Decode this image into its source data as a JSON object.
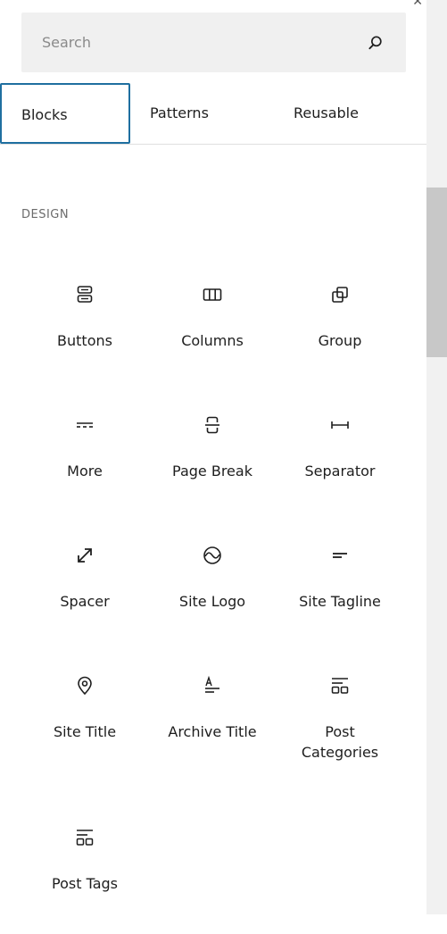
{
  "search": {
    "placeholder": "Search",
    "value": ""
  },
  "tabs": [
    {
      "label": "Blocks",
      "active": true
    },
    {
      "label": "Patterns",
      "active": false
    },
    {
      "label": "Reusable",
      "active": false
    }
  ],
  "category": {
    "title": "DESIGN"
  },
  "blocks": [
    {
      "label": "Buttons",
      "icon": "buttons-icon"
    },
    {
      "label": "Columns",
      "icon": "columns-icon"
    },
    {
      "label": "Group",
      "icon": "group-icon"
    },
    {
      "label": "More",
      "icon": "more-icon"
    },
    {
      "label": "Page Break",
      "icon": "page-break-icon"
    },
    {
      "label": "Separator",
      "icon": "separator-icon"
    },
    {
      "label": "Spacer",
      "icon": "spacer-icon"
    },
    {
      "label": "Site Logo",
      "icon": "site-logo-icon"
    },
    {
      "label": "Site Tagline",
      "icon": "site-tagline-icon"
    },
    {
      "label": "Site Title",
      "icon": "map-marker-icon"
    },
    {
      "label": "Archive Title",
      "icon": "archive-title-icon"
    },
    {
      "label": "Post Categories",
      "icon": "post-categories-icon"
    },
    {
      "label": "Post Tags",
      "icon": "post-tags-icon"
    }
  ],
  "colors": {
    "accent": "#1f6fa0",
    "search_bg": "#f0f0f0",
    "text": "#1e1e1e",
    "muted": "#6b6b6b"
  }
}
